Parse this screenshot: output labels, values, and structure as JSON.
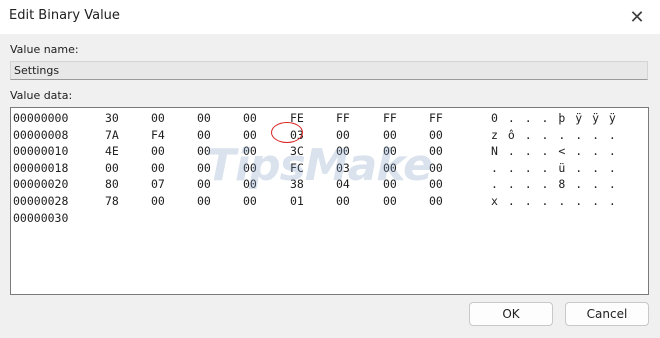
{
  "window": {
    "title": "Edit Binary Value",
    "close_glyph": "✕"
  },
  "value_name": {
    "label": "Value name:",
    "value": "Settings"
  },
  "value_data": {
    "label": "Value data:",
    "rows": [
      {
        "address": "00000000",
        "bytes": [
          "30",
          "00",
          "00",
          "00",
          "FE",
          "FF",
          "FF",
          "FF"
        ],
        "ascii": "0 . . . þ ÿ ÿ ÿ"
      },
      {
        "address": "00000008",
        "bytes": [
          "7A",
          "F4",
          "00",
          "00",
          "03",
          "00",
          "00",
          "00"
        ],
        "ascii": "z ô . . . . . ."
      },
      {
        "address": "00000010",
        "bytes": [
          "4E",
          "00",
          "00",
          "00",
          "3C",
          "00",
          "00",
          "00"
        ],
        "ascii": "N . . . < . . ."
      },
      {
        "address": "00000018",
        "bytes": [
          "00",
          "00",
          "00",
          "00",
          "FC",
          "03",
          "00",
          "00"
        ],
        "ascii": ". . . . ü . . ."
      },
      {
        "address": "00000020",
        "bytes": [
          "80",
          "07",
          "00",
          "00",
          "38",
          "04",
          "00",
          "00"
        ],
        "ascii": ". . . . 8 . . ."
      },
      {
        "address": "00000028",
        "bytes": [
          "78",
          "00",
          "00",
          "00",
          "01",
          "00",
          "00",
          "00"
        ],
        "ascii": "x . . . . . . ."
      },
      {
        "address": "00000030",
        "bytes": [],
        "ascii": ""
      }
    ]
  },
  "watermark": "TipsMake",
  "buttons": {
    "ok_label": "OK",
    "cancel_label": "Cancel"
  },
  "highlight_color": "#d82020"
}
